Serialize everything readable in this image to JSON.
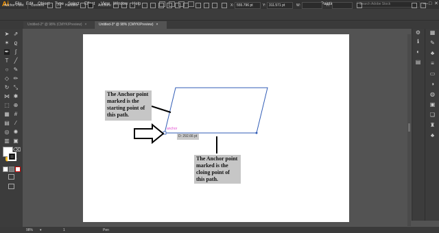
{
  "app": {
    "logo": "Ai"
  },
  "menu": [
    "File",
    "Edit",
    "Object",
    "Type",
    "Select",
    "Effect",
    "View",
    "Window",
    "Help"
  ],
  "workspace": {
    "label": "Painting",
    "caret": "▾"
  },
  "search": {
    "placeholder": "Search Adobe Stock"
  },
  "window_controls": {
    "minimize": "—",
    "maximize": "□",
    "close": "✕"
  },
  "control_bar": {
    "tool_name": "Anchor Point",
    "convert_label": "Convert:",
    "handles_label": "Handles:",
    "anchors_label": "Anchors:",
    "x_label": "X:",
    "x_value": "555.796 pt",
    "y_label": "Y:",
    "y_value": "311.571 pt",
    "w_label": "W:",
    "h_label": "H:"
  },
  "tabs": [
    {
      "label": "Untitled-2* @ 98% (CMYK/Preview)",
      "close": "×",
      "active": false
    },
    {
      "label": "Untitled-3* @ 98% (CMYK/Preview)",
      "close": "×",
      "active": true
    }
  ],
  "canvas": {
    "anchor_tag": "anchor",
    "measure_tip": "D: 292.66 pt",
    "callout_start": "The Anchor point marked is the starting point of this path.",
    "callout_end": "The Anchor point marked is the cloing point of this path.",
    "path_color": "#2f5bb5",
    "anchor_color": "#e24ad0"
  },
  "status_bar": {
    "zoom": "98%",
    "page": "1",
    "tool": "Pen"
  },
  "colors": {
    "accent": "#ff9a00",
    "chrome_dark": "#323232",
    "chrome": "#3c3c3c",
    "pasteboard": "#535353"
  }
}
